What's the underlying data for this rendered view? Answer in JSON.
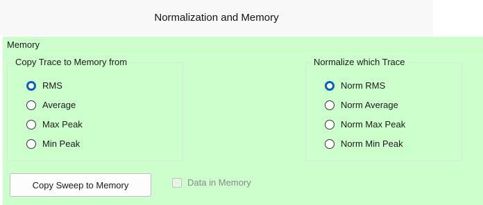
{
  "window": {
    "title": "Normalization and Memory"
  },
  "memory_panel": {
    "label": "Memory",
    "copy_group": {
      "legend": "Copy Trace to Memory from",
      "options": [
        "RMS",
        "Average",
        "Max Peak",
        "Min Peak"
      ],
      "selected": "RMS"
    },
    "normalize_group": {
      "legend": "Normalize which Trace",
      "options": [
        "Norm RMS",
        "Norm Average",
        "Norm Max Peak",
        "Norm Min Peak"
      ],
      "selected": "Norm RMS"
    },
    "copy_button_label": "Copy Sweep to Memory",
    "data_in_memory": {
      "label": "Data in Memory",
      "checked": false,
      "enabled": false
    }
  },
  "colors": {
    "panel_bg": "#ccffcc",
    "radio_selected": "#0a5bc4",
    "title_bg": "#f8f8f8"
  }
}
